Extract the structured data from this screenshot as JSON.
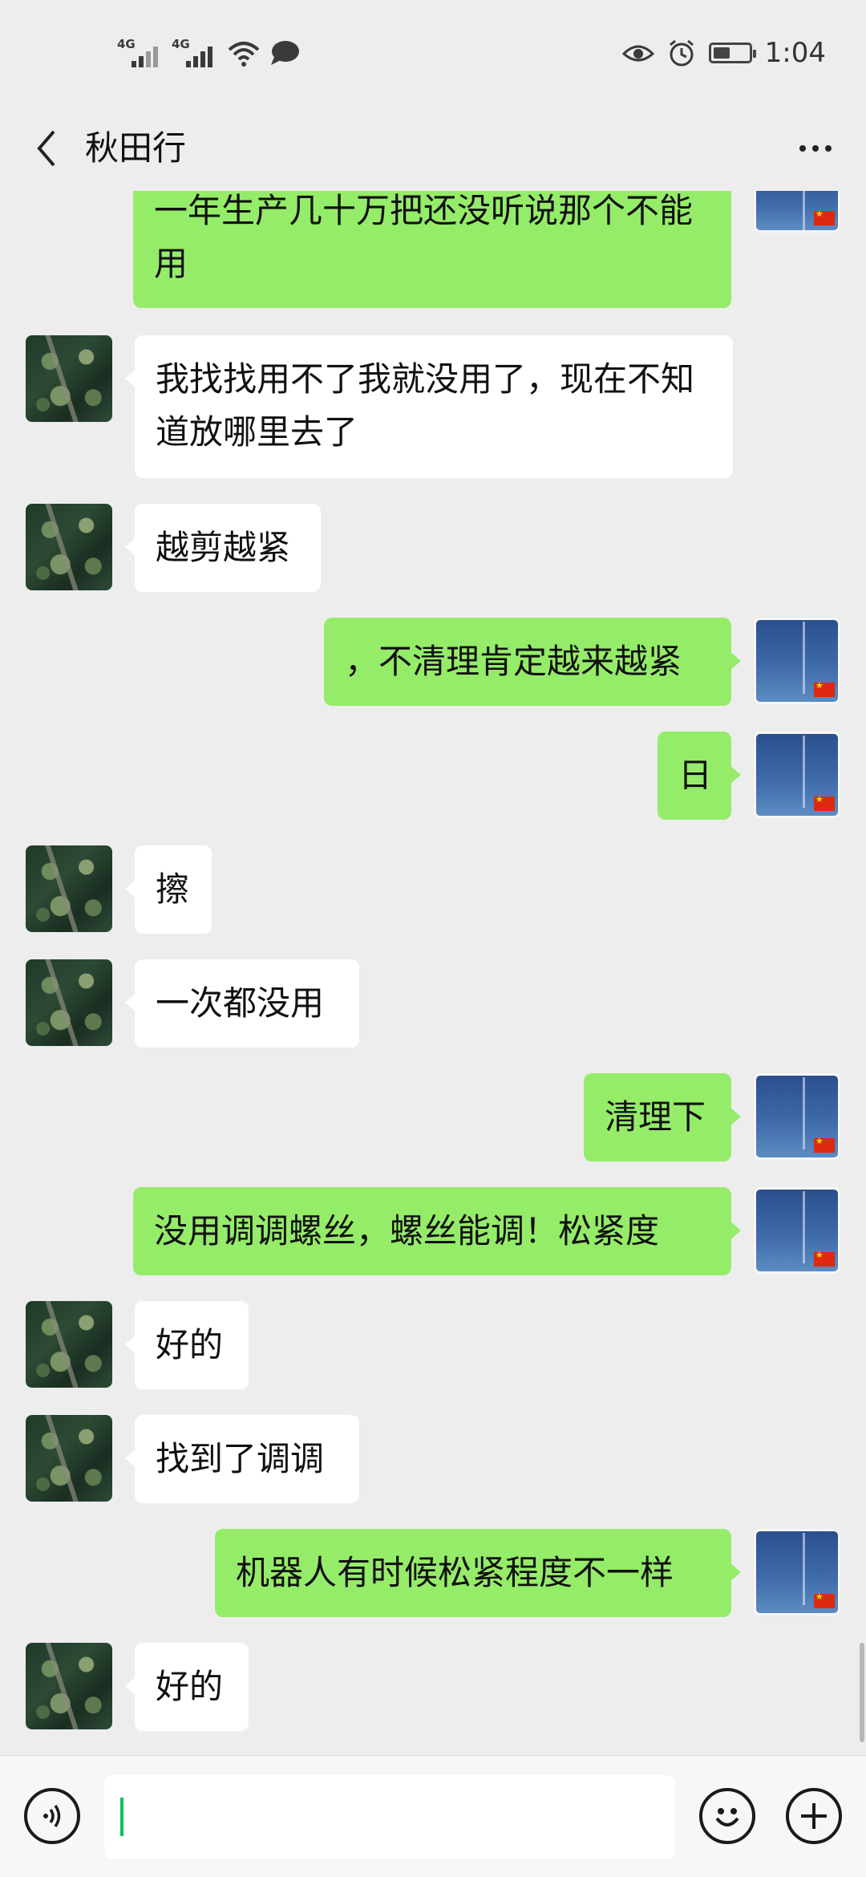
{
  "status_bar": {
    "signal1_label": "4G",
    "signal2_label": "4G",
    "time": "1:04",
    "battery_level": 0.45
  },
  "header": {
    "title": "秋田行"
  },
  "messages": [
    {
      "side": "right",
      "text": "一年生产几十万把还没听说那个不能用"
    },
    {
      "side": "left",
      "text": "我找找用不了我就没用了，现在不知道放哪里去了"
    },
    {
      "side": "left",
      "text": "越剪越紧"
    },
    {
      "side": "right",
      "text": "，不清理肯定越来越紧"
    },
    {
      "side": "right",
      "text": "日"
    },
    {
      "side": "left",
      "text": "擦"
    },
    {
      "side": "left",
      "text": "一次都没用"
    },
    {
      "side": "right",
      "text": "清理下"
    },
    {
      "side": "right",
      "text": "没用调调螺丝，螺丝能调！松紧度"
    },
    {
      "side": "left",
      "text": "好的"
    },
    {
      "side": "left",
      "text": "找到了调调"
    },
    {
      "side": "right",
      "text": "机器人有时候松紧程度不一样"
    },
    {
      "side": "left",
      "text": "好的"
    }
  ],
  "input": {
    "value": "",
    "placeholder": ""
  },
  "colors": {
    "background": "#ededed",
    "bubble_self": "#95ec69",
    "bubble_other": "#ffffff",
    "caret": "#07c160"
  },
  "icons": {
    "back": "chevron-left-icon",
    "more": "more-dots-icon",
    "voice": "voice-icon",
    "emoji": "emoji-icon",
    "plus": "plus-icon"
  }
}
